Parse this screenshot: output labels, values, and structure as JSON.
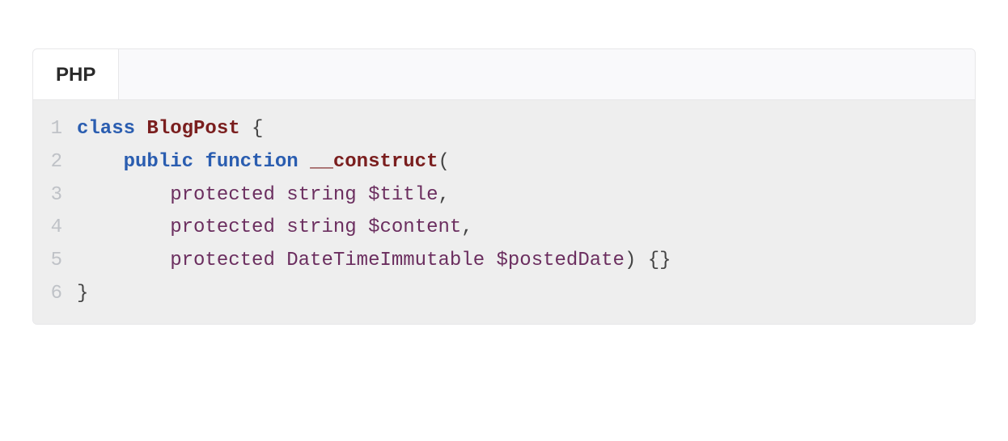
{
  "tab": {
    "label": "PHP"
  },
  "code": {
    "lines": [
      {
        "n": "1"
      },
      {
        "n": "2"
      },
      {
        "n": "3"
      },
      {
        "n": "4"
      },
      {
        "n": "5"
      },
      {
        "n": "6"
      }
    ],
    "tokens": {
      "l1": {
        "kw_class": "class",
        "sp1": " ",
        "classname": "BlogPost",
        "sp2": " ",
        "brace_open": "{"
      },
      "l2": {
        "indent": "    ",
        "kw_public": "public",
        "sp1": " ",
        "kw_function": "function",
        "sp2": " ",
        "func": "__construct",
        "paren_open": "("
      },
      "l3": {
        "indent": "        ",
        "mod": "protected",
        "sp1": " ",
        "type": "string",
        "sp2": " ",
        "var": "$title",
        "comma": ","
      },
      "l4": {
        "indent": "        ",
        "mod": "protected",
        "sp1": " ",
        "type": "string",
        "sp2": " ",
        "var": "$content",
        "comma": ","
      },
      "l5": {
        "indent": "        ",
        "mod": "protected",
        "sp1": " ",
        "type": "DateTimeImmutable",
        "sp2": " ",
        "var": "$postedDate",
        "paren_close": ")",
        "sp3": " ",
        "braces": "{}"
      },
      "l6": {
        "brace_close": "}"
      }
    }
  }
}
